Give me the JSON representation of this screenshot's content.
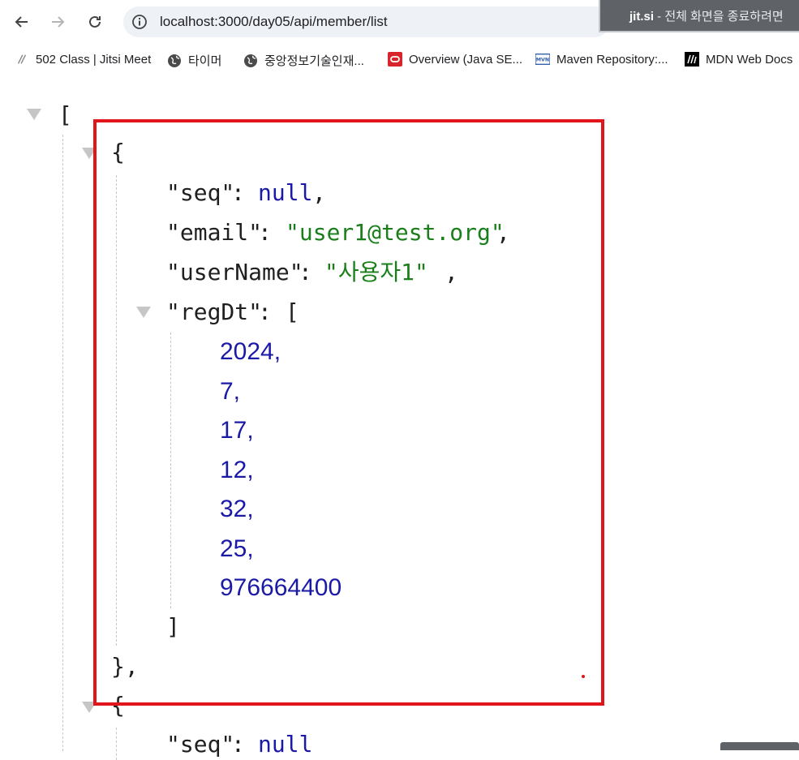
{
  "browser": {
    "url": "localhost:3000/day05/api/member/list",
    "share_banner": {
      "app": "jit.si",
      "text": " - 전체 화면을 종료하려면"
    }
  },
  "bookmarks": [
    {
      "label": "502 Class | Jitsi Meet",
      "icon": "jitsi-icon"
    },
    {
      "label": "타이머",
      "icon": "globe-icon"
    },
    {
      "label": "중앙정보기술인재...",
      "icon": "globe-icon"
    },
    {
      "label": "Overview (Java SE...",
      "icon": "oracle-icon"
    },
    {
      "label": "Maven Repository:...",
      "icon": "maven-icon"
    },
    {
      "label": "MDN Web Docs",
      "icon": "mdn-icon"
    }
  ],
  "json_view": {
    "open_array": "[",
    "record": {
      "open_brace": "{",
      "seq_key": "\"seq\"",
      "colon": ": ",
      "seq_value": "null",
      "comma": ",",
      "email_key": "\"email\"",
      "email_value": "\"user1@test.org\"",
      "username_key": "\"userName\"",
      "username_value": "\"사용자1\"",
      "regdt_key": "\"regDt\"",
      "regdt_open": "[",
      "regdt_values": [
        "2024,",
        "7,",
        "17,",
        "12,",
        "32,",
        "25,",
        "976664400"
      ],
      "regdt_close": "]",
      "close_brace": "},"
    },
    "next_record": {
      "open_brace": "{",
      "seq_key": "\"seq\"",
      "seq_value": "null"
    }
  }
}
